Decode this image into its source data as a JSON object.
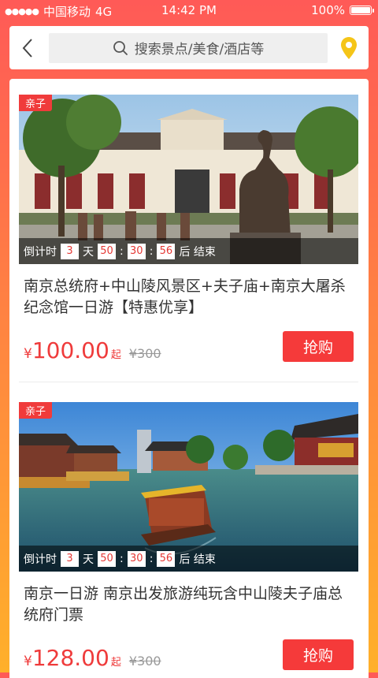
{
  "status": {
    "carrier": "中国移动",
    "network": "4G",
    "time": "14:42 PM",
    "battery": "100%",
    "battery_level": 1.0
  },
  "header": {
    "search_placeholder": "搜索景点/美食/酒店等",
    "icons": [
      "back-arrow-icon",
      "search-icon",
      "location-pin-icon"
    ]
  },
  "products": [
    {
      "tag": "亲子",
      "countdown": {
        "prefix": "倒计时",
        "days": "3",
        "day_label": "天",
        "hours": "50",
        "minutes": "30",
        "seconds": "56",
        "suffix": "后 结束"
      },
      "title": "南京总统府+中山陵风景区+夫子庙+南京大屠杀纪念馆一日游【特惠优享】",
      "currency": "¥",
      "price": "100.00",
      "price_suffix": "起",
      "original_price": "¥300",
      "buy_label": "抢购"
    },
    {
      "tag": "亲子",
      "countdown": {
        "prefix": "倒计时",
        "days": "3",
        "day_label": "天",
        "hours": "50",
        "minutes": "30",
        "seconds": "56",
        "suffix": "后 结束"
      },
      "title": "南京一日游 南京出发旅游纯玩含中山陵夫子庙总统府门票",
      "currency": "¥",
      "price": "128.00",
      "price_suffix": "起",
      "original_price": "¥300",
      "buy_label": "抢购"
    }
  ],
  "colors": {
    "accent": "#f53a3a",
    "price": "#ef3b3b",
    "pin": "#f5c518"
  }
}
